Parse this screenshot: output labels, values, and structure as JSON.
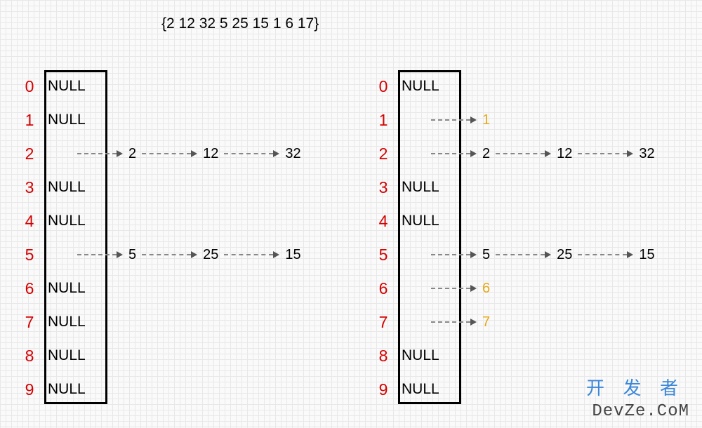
{
  "title_text": "{2 12 32  5 25   15 1 6 17}",
  "watermark_cn": "开 发 者",
  "watermark_en": "DevZe.CoM",
  "chart_data": [
    {
      "type": "table",
      "title": "hash table before inserting 1,6,17",
      "buckets": [
        {
          "index": 0,
          "content": "NULL",
          "chain": []
        },
        {
          "index": 1,
          "content": "NULL",
          "chain": []
        },
        {
          "index": 2,
          "content": "",
          "chain": [
            {
              "v": "2"
            },
            {
              "v": "12"
            },
            {
              "v": "32"
            }
          ]
        },
        {
          "index": 3,
          "content": "NULL",
          "chain": []
        },
        {
          "index": 4,
          "content": "NULL",
          "chain": []
        },
        {
          "index": 5,
          "content": "",
          "chain": [
            {
              "v": "5"
            },
            {
              "v": "25"
            },
            {
              "v": "15"
            }
          ]
        },
        {
          "index": 6,
          "content": "NULL",
          "chain": []
        },
        {
          "index": 7,
          "content": "NULL",
          "chain": []
        },
        {
          "index": 8,
          "content": "NULL",
          "chain": []
        },
        {
          "index": 9,
          "content": "NULL",
          "chain": []
        }
      ]
    },
    {
      "type": "table",
      "title": "hash table after inserting 1,6,7",
      "buckets": [
        {
          "index": 0,
          "content": "NULL",
          "chain": []
        },
        {
          "index": 1,
          "content": "",
          "chain": [
            {
              "v": "1",
              "hl": true
            }
          ]
        },
        {
          "index": 2,
          "content": "",
          "chain": [
            {
              "v": "2"
            },
            {
              "v": "12"
            },
            {
              "v": "32"
            }
          ]
        },
        {
          "index": 3,
          "content": "NULL",
          "chain": []
        },
        {
          "index": 4,
          "content": "NULL",
          "chain": []
        },
        {
          "index": 5,
          "content": "",
          "chain": [
            {
              "v": "5"
            },
            {
              "v": "25"
            },
            {
              "v": "15"
            }
          ]
        },
        {
          "index": 6,
          "content": "",
          "chain": [
            {
              "v": "6",
              "hl": true
            }
          ]
        },
        {
          "index": 7,
          "content": "",
          "chain": [
            {
              "v": "7",
              "hl": true
            }
          ]
        },
        {
          "index": 8,
          "content": "NULL",
          "chain": []
        },
        {
          "index": 9,
          "content": "NULL",
          "chain": []
        }
      ]
    }
  ],
  "row_spacing": 48,
  "arrow_widths": {
    "first": 56,
    "rest": 70
  }
}
